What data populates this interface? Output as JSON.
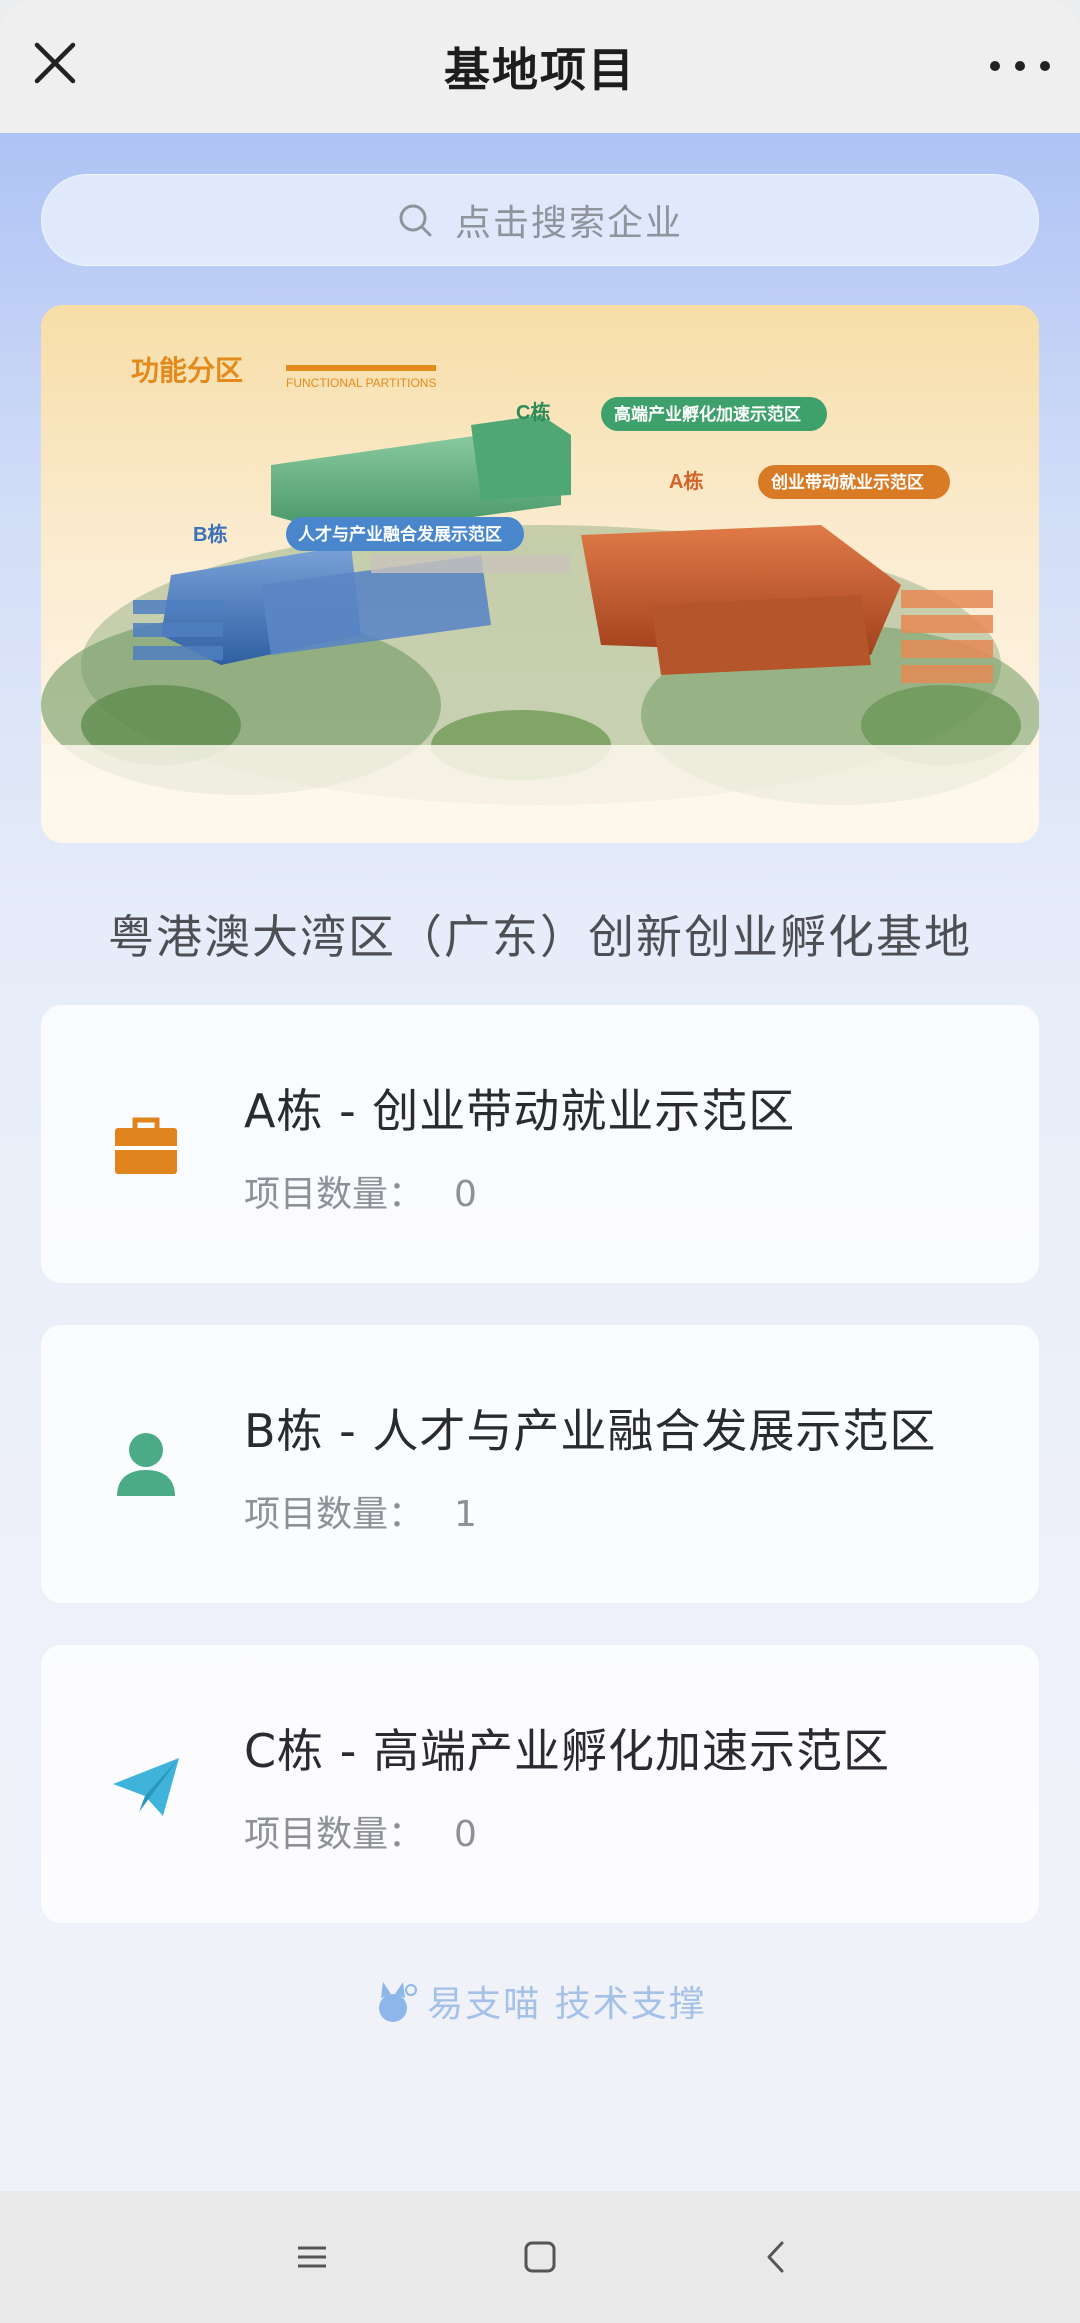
{
  "header": {
    "title": "基地项目",
    "close_icon": "close-icon",
    "more_icon": "more-dots-icon"
  },
  "search": {
    "placeholder": "点击搜索企业",
    "icon": "search-icon"
  },
  "banner": {
    "heading": "功能分区",
    "heading_en": "FUNCTIONAL PARTITIONS",
    "tags": {
      "c": "高端产业孵化加速示范区",
      "a": "创业带动就业示范区",
      "b": "人才与产业融合发展示范区"
    },
    "building_labels": {
      "a": "A栋",
      "b": "B栋",
      "c": "C栋"
    }
  },
  "base_name": "粤港澳大湾区（广东）创新创业孵化基地",
  "cards": [
    {
      "name": "A栋 - 创业带动就业示范区",
      "count_label": "项目数量：",
      "count": "0",
      "icon": "briefcase-icon",
      "color": "#e0841d"
    },
    {
      "name": "B栋 - 人才与产业融合发展示范区",
      "count_label": "项目数量：",
      "count": "1",
      "icon": "user-icon",
      "color": "#4bab86"
    },
    {
      "name": "C栋 - 高端产业孵化加速示范区",
      "count_label": "项目数量：",
      "count": "0",
      "icon": "paper-plane-icon",
      "color": "#3fb3d9"
    }
  ],
  "footer": {
    "text": "易支喵 技术支撑",
    "icon": "cat-logo-icon"
  },
  "navbar": {
    "menu": "menu-icon",
    "home": "home-square-icon",
    "back": "back-chevron-icon"
  }
}
